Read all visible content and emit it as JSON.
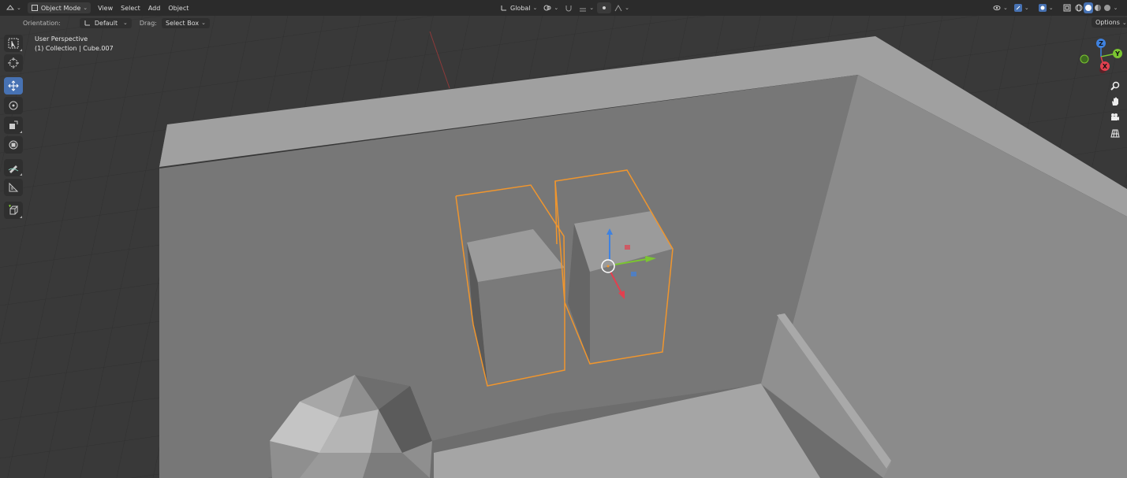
{
  "header": {
    "mode_label": "Object Mode",
    "menus": [
      "View",
      "Select",
      "Add",
      "Object"
    ],
    "transform_orientation": "Global"
  },
  "tool_settings": {
    "orientation_label": "Orientation:",
    "orientation_value": "Default",
    "drag_label": "Drag:",
    "drag_value": "Select Box",
    "options_label": "Options"
  },
  "viewport": {
    "perspective_label": "User Perspective",
    "collection_label": "(1) Collection | Cube.007",
    "selection_color": "#f0962e",
    "background_color": "#393939"
  },
  "left_toolbar": {
    "tools": [
      {
        "name": "select-box",
        "active": false
      },
      {
        "name": "cursor",
        "active": false
      },
      {
        "name": "move",
        "active": true
      },
      {
        "name": "rotate",
        "active": false
      },
      {
        "name": "scale",
        "active": false
      },
      {
        "name": "transform",
        "active": false
      },
      {
        "name": "annotate",
        "active": false
      },
      {
        "name": "measure",
        "active": false
      },
      {
        "name": "add-cube",
        "active": false
      }
    ]
  },
  "navigation_gizmo": {
    "axes": [
      "Z",
      "Y",
      "X"
    ],
    "colors": {
      "x": "#e2404f",
      "y": "#7bc531",
      "z": "#3f82e0"
    }
  },
  "nav_buttons": [
    "zoom-icon",
    "hand-icon",
    "camera-icon",
    "grid-icon"
  ]
}
